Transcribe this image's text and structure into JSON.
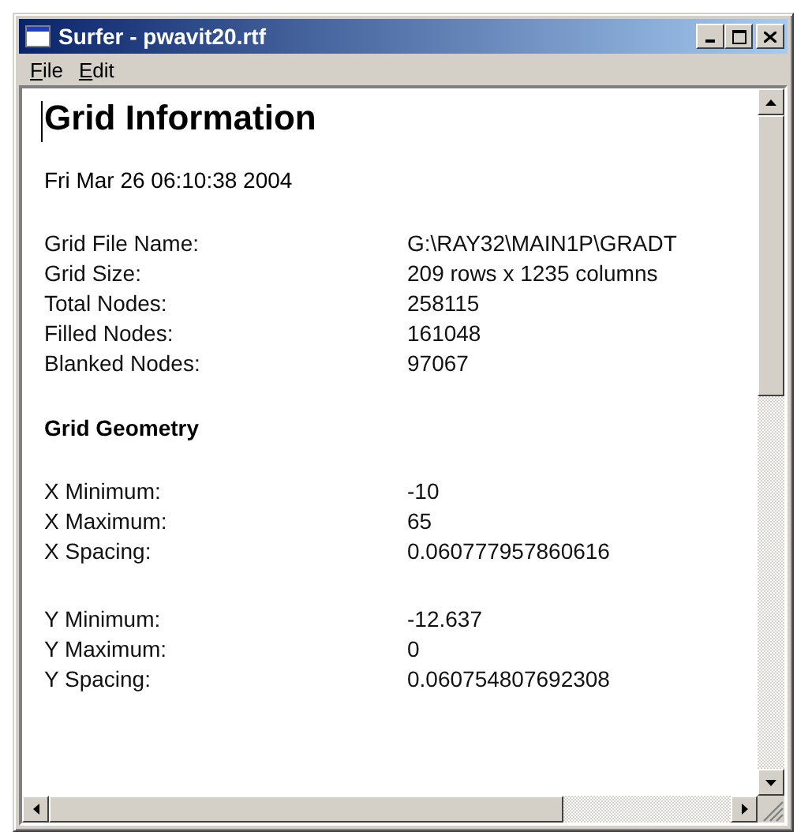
{
  "window": {
    "title": "Surfer - pwavit20.rtf"
  },
  "menu": [
    {
      "accel": "F",
      "rest": "ile"
    },
    {
      "accel": "E",
      "rest": "dit"
    }
  ],
  "document": {
    "title": "Grid Information",
    "date": "Fri Mar 26 06:10:38 2004",
    "blocks": [
      {
        "kind": "rows",
        "rows": [
          {
            "label": "Grid File Name:",
            "value": "G:\\RAY32\\MAIN1P\\GRADT"
          },
          {
            "label": "Grid Size:",
            "value": "209 rows x 1235 columns"
          },
          {
            "label": "Total Nodes:",
            "value": "258115"
          },
          {
            "label": "Filled Nodes:",
            "value": "161048"
          },
          {
            "label": "Blanked Nodes:",
            "value": "97067"
          }
        ]
      },
      {
        "kind": "heading",
        "text": "Grid Geometry"
      },
      {
        "kind": "rows",
        "rows": [
          {
            "label": "X Minimum:",
            "value": "-10"
          },
          {
            "label": "X Maximum:",
            "value": "65"
          },
          {
            "label": "X Spacing:",
            "value": "0.060777957860616"
          }
        ]
      },
      {
        "kind": "rows",
        "rows": [
          {
            "label": "Y Minimum:",
            "value": "-12.637"
          },
          {
            "label": "Y Maximum:",
            "value": "0"
          },
          {
            "label": "Y Spacing:",
            "value": "0.060754807692308"
          }
        ]
      }
    ]
  }
}
